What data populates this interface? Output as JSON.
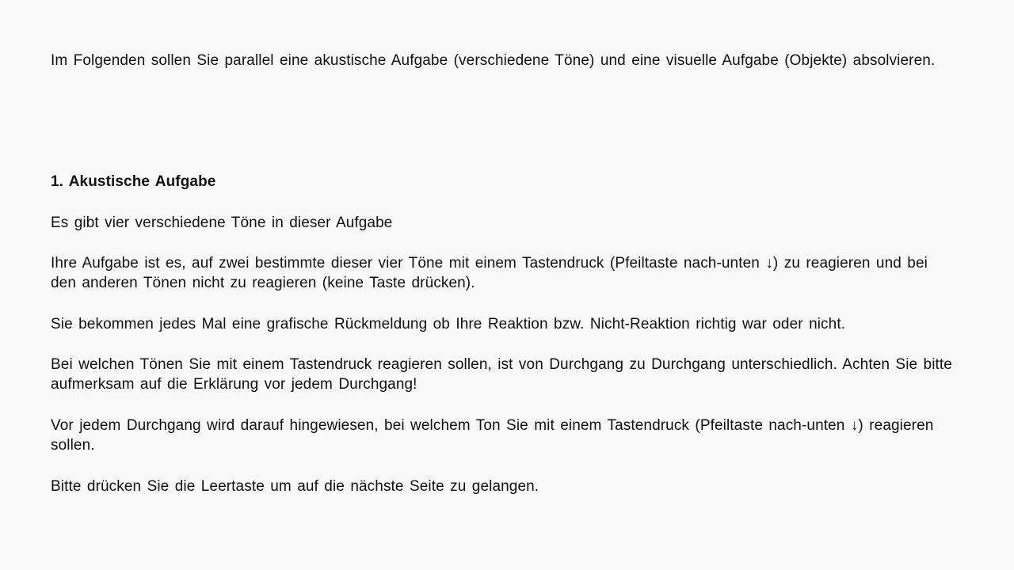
{
  "intro": "Im Folgenden sollen Sie parallel eine akustische Aufgabe (verschiedene Töne) und eine visuelle Aufgabe (Objekte) absolvieren.",
  "section_heading": "1. Akustische Aufgabe",
  "paragraphs": [
    "Es gibt vier verschiedene Töne in dieser Aufgabe",
    "Ihre Aufgabe ist es, auf zwei bestimmte dieser vier Töne mit einem Tastendruck (Pfeiltaste nach-unten ↓) zu reagieren und bei den anderen Tönen nicht zu reagieren (keine Taste drücken).",
    "Sie bekommen jedes Mal eine grafische Rückmeldung ob Ihre Reaktion bzw. Nicht-Reaktion richtig war oder nicht.",
    "Bei welchen Tönen Sie mit einem Tastendruck reagieren sollen, ist von Durchgang zu Durchgang unterschiedlich. Achten Sie bitte aufmerksam auf die Erklärung vor jedem Durchgang!",
    "Vor jedem Durchgang wird darauf hingewiesen, bei welchem Ton Sie mit einem Tastendruck (Pfeiltaste nach-unten ↓) reagieren sollen.",
    "Bitte drücken Sie die Leertaste um auf die nächste Seite zu gelangen."
  ]
}
